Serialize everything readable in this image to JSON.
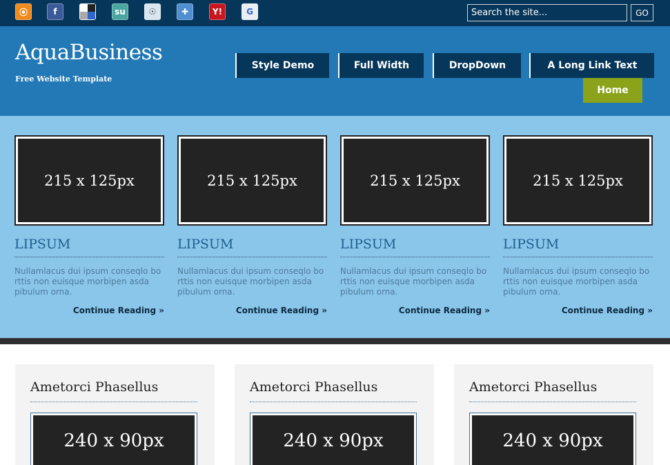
{
  "social_icons": [
    {
      "name": "rss-icon",
      "glyph": "⦿"
    },
    {
      "name": "facebook-icon",
      "glyph": "f"
    },
    {
      "name": "delicious-icon",
      "glyph": ""
    },
    {
      "name": "stumbleupon-icon",
      "glyph": "su"
    },
    {
      "name": "reddit-icon",
      "glyph": "☉"
    },
    {
      "name": "technorati-icon",
      "glyph": "✚"
    },
    {
      "name": "yahoo-icon",
      "glyph": "Y!"
    },
    {
      "name": "google-icon",
      "glyph": "G"
    }
  ],
  "search": {
    "placeholder": "Search the site...",
    "button_label": "GO"
  },
  "header": {
    "logo": "AquaBusiness",
    "tagline": "Free Website Template"
  },
  "nav": {
    "items": [
      "Style Demo",
      "Full Width",
      "DropDown",
      "A Long Link Text"
    ],
    "home": "Home"
  },
  "colors": {
    "topbar": "#063659",
    "header": "#2279b6",
    "featured_bg": "#8ac5ea",
    "home_accent": "#8ba31a"
  },
  "featured": [
    {
      "thumb": "215 x 125px",
      "title": "LIPSUM",
      "text": "Nullamlacus dui ipsum conseqlo bo rttis non euisque morbipen asda pibulum orna.",
      "more": "Continue Reading »"
    },
    {
      "thumb": "215 x 125px",
      "title": "LIPSUM",
      "text": "Nullamlacus dui ipsum conseqlo bo rttis non euisque morbipen asda pibulum orna.",
      "more": "Continue Reading »"
    },
    {
      "thumb": "215 x 125px",
      "title": "LIPSUM",
      "text": "Nullamlacus dui ipsum conseqlo bo rttis non euisque morbipen asda pibulum orna.",
      "more": "Continue Reading »"
    },
    {
      "thumb": "215 x 125px",
      "title": "LIPSUM",
      "text": "Nullamlacus dui ipsum conseqlo bo rttis non euisque morbipen asda pibulum orna.",
      "more": "Continue Reading »"
    }
  ],
  "boxes": [
    {
      "title": "Ametorci Phasellus",
      "thumb": "240 x 90px"
    },
    {
      "title": "Ametorci Phasellus",
      "thumb": "240 x 90px"
    },
    {
      "title": "Ametorci Phasellus",
      "thumb": "240 x 90px"
    }
  ]
}
